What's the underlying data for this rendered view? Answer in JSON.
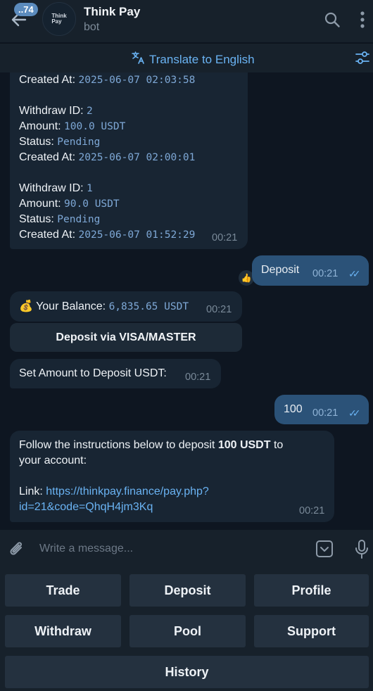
{
  "header": {
    "unread_count": "..74",
    "avatar_text_1": "Think",
    "avatar_text_2": "Pay",
    "title": "Think Pay",
    "subtitle": "bot"
  },
  "translate_bar": {
    "label": "Translate to English"
  },
  "messages": {
    "withdraw_list": {
      "top_created_label": "Created At:",
      "top_created_value": "2025-06-07 02:03:58",
      "entries": [
        {
          "id_label": "Withdraw ID:",
          "id": "2",
          "amount_label": "Amount:",
          "amount": "100.0 USDT",
          "status_label": "Status:",
          "status": "Pending",
          "created_label": "Created At:",
          "created": "2025-06-07 02:00:01"
        },
        {
          "id_label": "Withdraw ID:",
          "id": "1",
          "amount_label": "Amount:",
          "amount": "90.0 USDT",
          "status_label": "Status:",
          "status": "Pending",
          "created_label": "Created At:",
          "created": "2025-06-07 01:52:29"
        }
      ],
      "time": "00:21"
    },
    "out_deposit": {
      "text": "Deposit",
      "time": "00:21",
      "reaction": "👍"
    },
    "balance": {
      "emoji": "💰",
      "label": "Your Balance:",
      "value": "6,835.65 USDT",
      "time": "00:21",
      "button": "Deposit via VISA/MASTER"
    },
    "set_amount": {
      "text": "Set Amount to Deposit USDT:",
      "time": "00:21"
    },
    "out_amount": {
      "text": "100",
      "time": "00:21"
    },
    "instructions": {
      "line1_pre": "Follow the instructions below to deposit ",
      "line1_bold": "100 USDT",
      "line1_post": " to",
      "line2": "your account:",
      "link_label": "Link: ",
      "link_line1": "https://thinkpay.finance/pay.php?",
      "link_line2": "id=21&code=QhqH4jm3Kq",
      "time": "00:21"
    }
  },
  "composer": {
    "placeholder": "Write a message..."
  },
  "keyboard": {
    "rows": [
      [
        "Trade",
        "Deposit",
        "Profile"
      ],
      [
        "Withdraw",
        "Pool",
        "Support"
      ],
      [
        "History"
      ]
    ]
  },
  "colors": {
    "background": "#0e1621",
    "header": "#17212b",
    "incoming_bubble": "#182533",
    "outgoing_bubble": "#2b5278",
    "accent": "#6ab3f3"
  }
}
